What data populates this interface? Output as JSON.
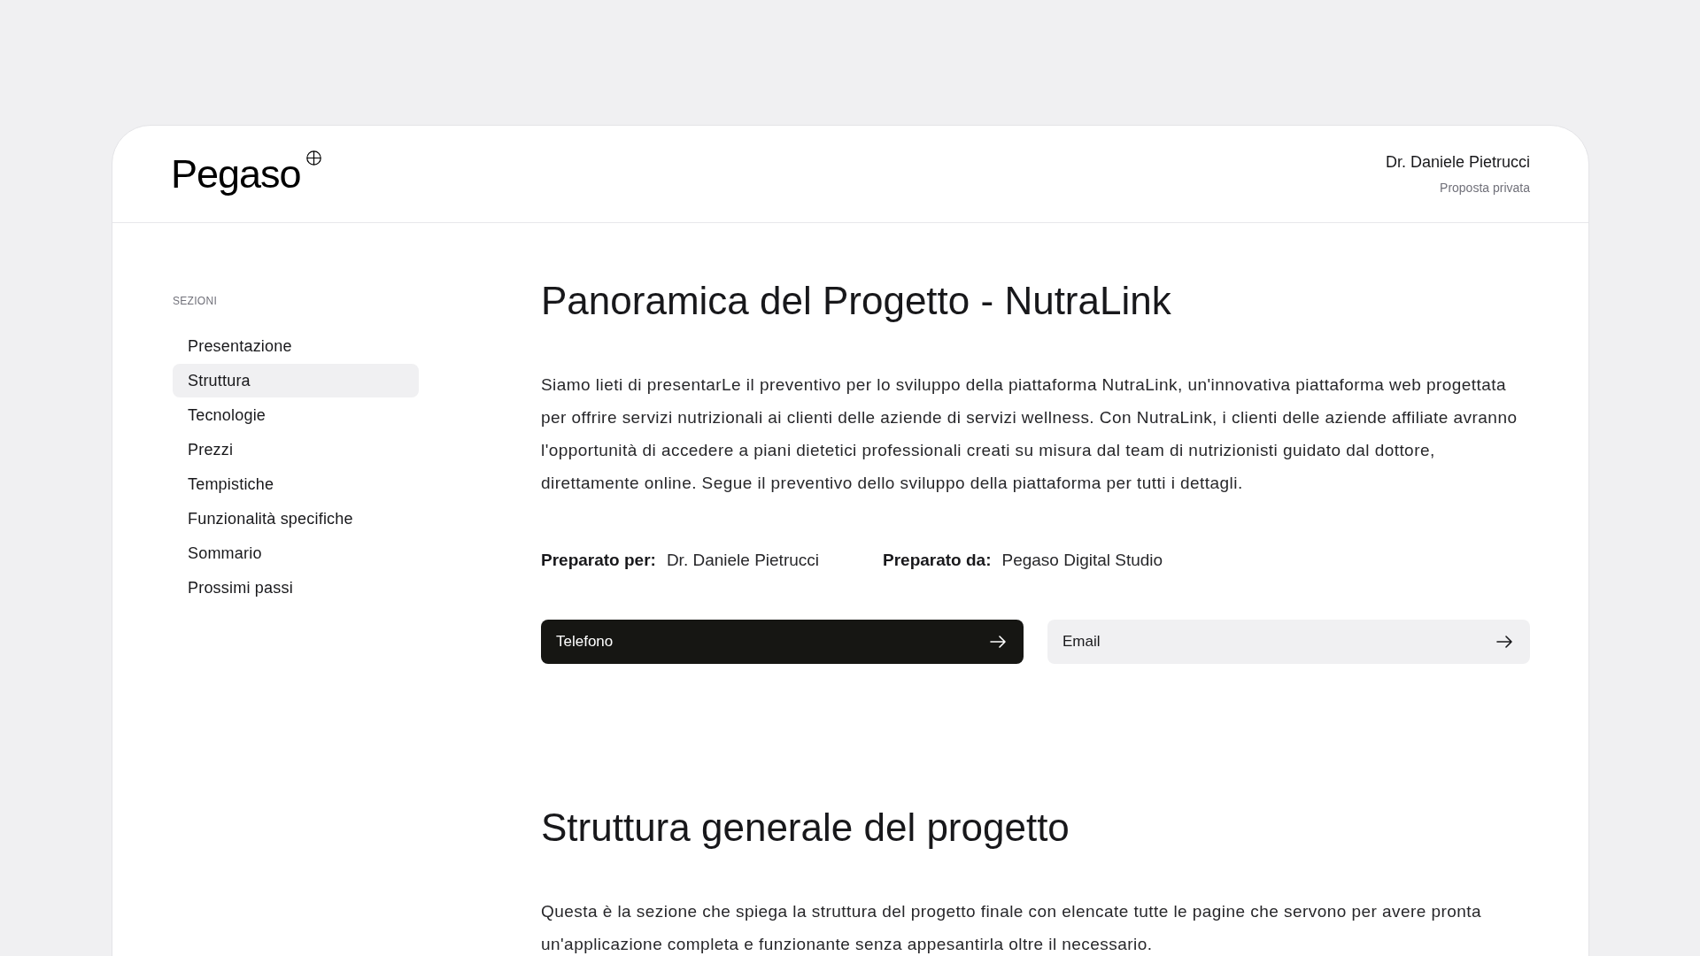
{
  "header": {
    "logo": "Pegaso",
    "user_name": "Dr. Daniele Pietrucci",
    "subtitle": "Proposta privata"
  },
  "sidebar": {
    "heading": "SEZIONI",
    "items": [
      {
        "label": "Presentazione",
        "selected": false
      },
      {
        "label": "Struttura",
        "selected": true
      },
      {
        "label": "Tecnologie",
        "selected": false
      },
      {
        "label": "Prezzi",
        "selected": false
      },
      {
        "label": "Tempistiche",
        "selected": false
      },
      {
        "label": "Funzionalità specifiche",
        "selected": false
      },
      {
        "label": "Sommario",
        "selected": false
      },
      {
        "label": "Prossimi passi",
        "selected": false
      }
    ]
  },
  "sections": [
    {
      "title": "Panoramica del Progetto - NutraLink",
      "paragraph": "Siamo lieti di presentarLe il preventivo per lo sviluppo della piattaforma NutraLink, un'innovativa piattaforma web progettata per offrire servizi nutrizionali ai clienti delle aziende di servizi wellness. Con NutraLink, i clienti delle aziende affiliate avranno l'opportunità di accedere a piani dietetici professionali creati su misura dal team di nutrizionisti guidato dal dottore, direttamente online. Segue il preventivo dello sviluppo della piattaforma per tutti i dettagli.",
      "prepared": [
        {
          "label": "Preparato per:",
          "value": "Dr. Daniele Pietrucci"
        },
        {
          "label": "Preparato da:",
          "value": "Pegaso Digital Studio"
        }
      ],
      "buttons": [
        {
          "label": "Telefono",
          "kind": "primary"
        },
        {
          "label": "Email",
          "kind": "secondary"
        }
      ]
    },
    {
      "title": "Struttura generale del progetto",
      "paragraph": "Questa è la sezione che spiega la struttura del progetto finale con elencate tutte le pagine che servono per avere pronta un'applicazione completa e funzionante senza appesantirla oltre il necessario."
    }
  ]
}
